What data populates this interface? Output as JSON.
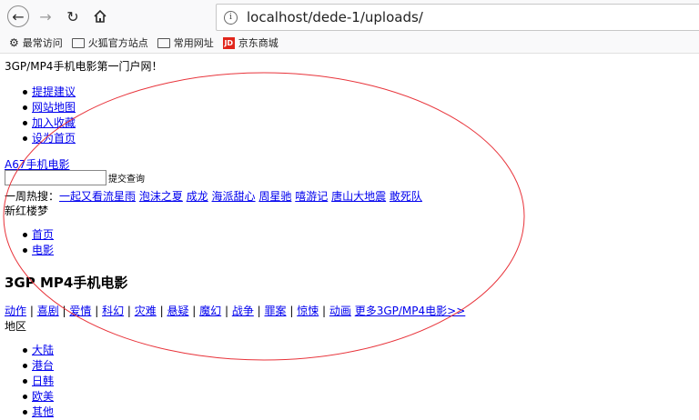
{
  "browser": {
    "url": "localhost/dede-1/uploads/",
    "bookmarks": [
      {
        "label": "最常访问",
        "icon": "gear-icon"
      },
      {
        "label": "火狐官方站点",
        "icon": "folder-icon"
      },
      {
        "label": "常用网址",
        "icon": "folder-icon"
      },
      {
        "label": "京东商城",
        "icon": "jd-icon",
        "icon_text": "JD"
      }
    ]
  },
  "page": {
    "tagline": "3GP/MP4手机电影第一门户网！",
    "top_links": [
      "提提建议",
      "网站地图",
      "加入收藏",
      "设为首页"
    ],
    "site_link": "A67手机电影",
    "search": {
      "placeholder": "",
      "submit_label": "提交查询"
    },
    "hot_search": {
      "label": "一周热搜：",
      "items": [
        "一起又看流星雨",
        "泡沫之夏",
        "成龙",
        "海派甜心",
        "周星驰",
        "嘻游记",
        "唐山大地震",
        "敢死队"
      ]
    },
    "featured": "新红楼梦",
    "nav_items": [
      "首页",
      "电影"
    ],
    "section_title": "3GP MP4手机电影",
    "genres": [
      "动作",
      "喜剧",
      "爱情",
      "科幻",
      "灾难",
      "悬疑",
      "魔幻",
      "战争",
      "罪案",
      "惊悚",
      "动画"
    ],
    "genre_separator": "|",
    "more_link": "更多3GP/MP4电影>>",
    "region_label": "地区",
    "regions": [
      "大陆",
      "港台",
      "日韩",
      "欧美",
      "其他"
    ]
  },
  "annotation": {
    "color": "#e8333a"
  }
}
